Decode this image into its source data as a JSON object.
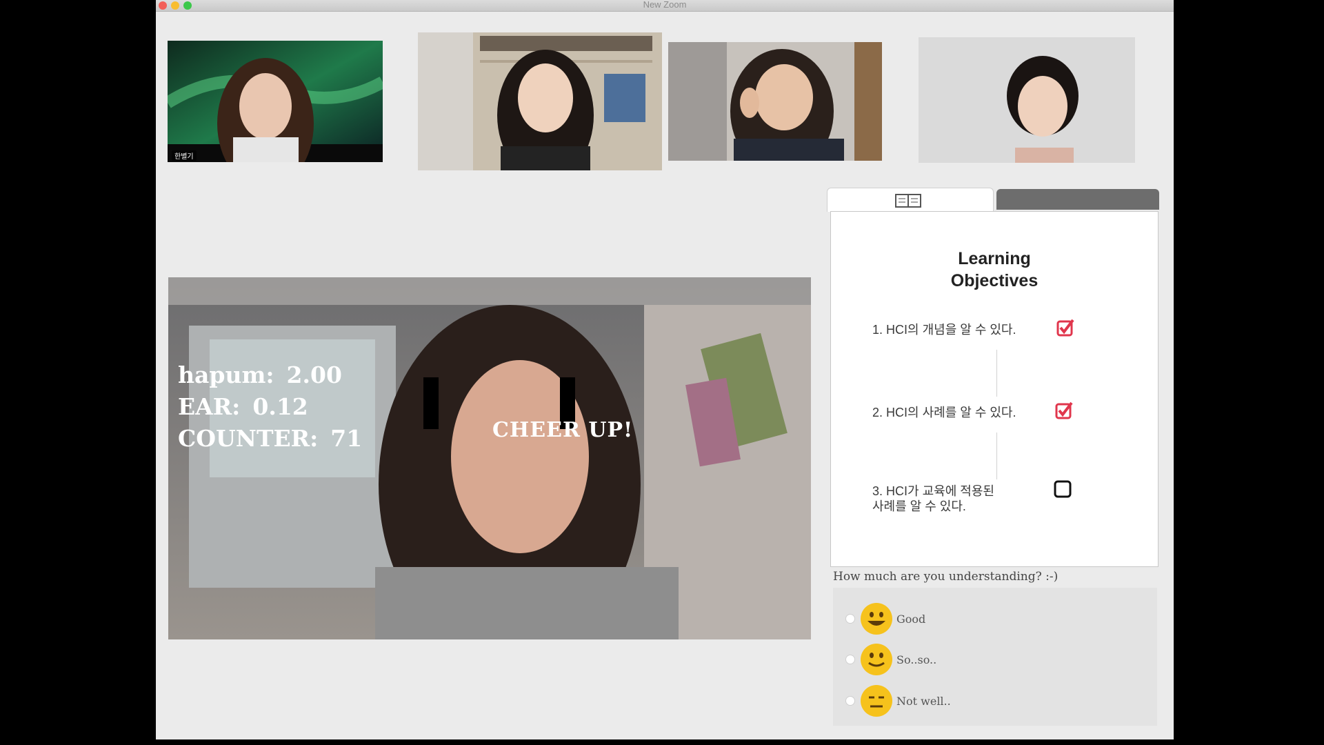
{
  "window": {
    "title": "New Zoom"
  },
  "participants": [
    {
      "name": "한별기"
    },
    {
      "name": ""
    },
    {
      "name": ""
    },
    {
      "name": ""
    }
  ],
  "main_video": {
    "metrics": [
      {
        "label": "hapum:",
        "value": "2.00"
      },
      {
        "label": "EAR:",
        "value": "0.12"
      },
      {
        "label": "COUNTER:",
        "value": "71"
      }
    ],
    "alert": "CHEER UP!"
  },
  "objectives": {
    "tab_icon": "book-icon",
    "title_line1": "Learning",
    "title_line2": "Objectives",
    "items": [
      {
        "line1": "1. HCI의 개념을 알 수 있다.",
        "line2": "",
        "checked": true
      },
      {
        "line1": "2. HCI의 사례를 알 수 있다.",
        "line2": "",
        "checked": true
      },
      {
        "line1": "3. HCI가 교육에 적용된",
        "line2": "사례를 알 수 있다.",
        "checked": false
      }
    ],
    "check_color": "#e0364c"
  },
  "feedback": {
    "question": "How much are you understanding? :-)",
    "options": [
      {
        "label": "Good",
        "icon": "grinning-emoji-icon"
      },
      {
        "label": "So..so..",
        "icon": "smiling-emoji-icon"
      },
      {
        "label": "Not well..",
        "icon": "neutral-emoji-icon"
      }
    ]
  }
}
